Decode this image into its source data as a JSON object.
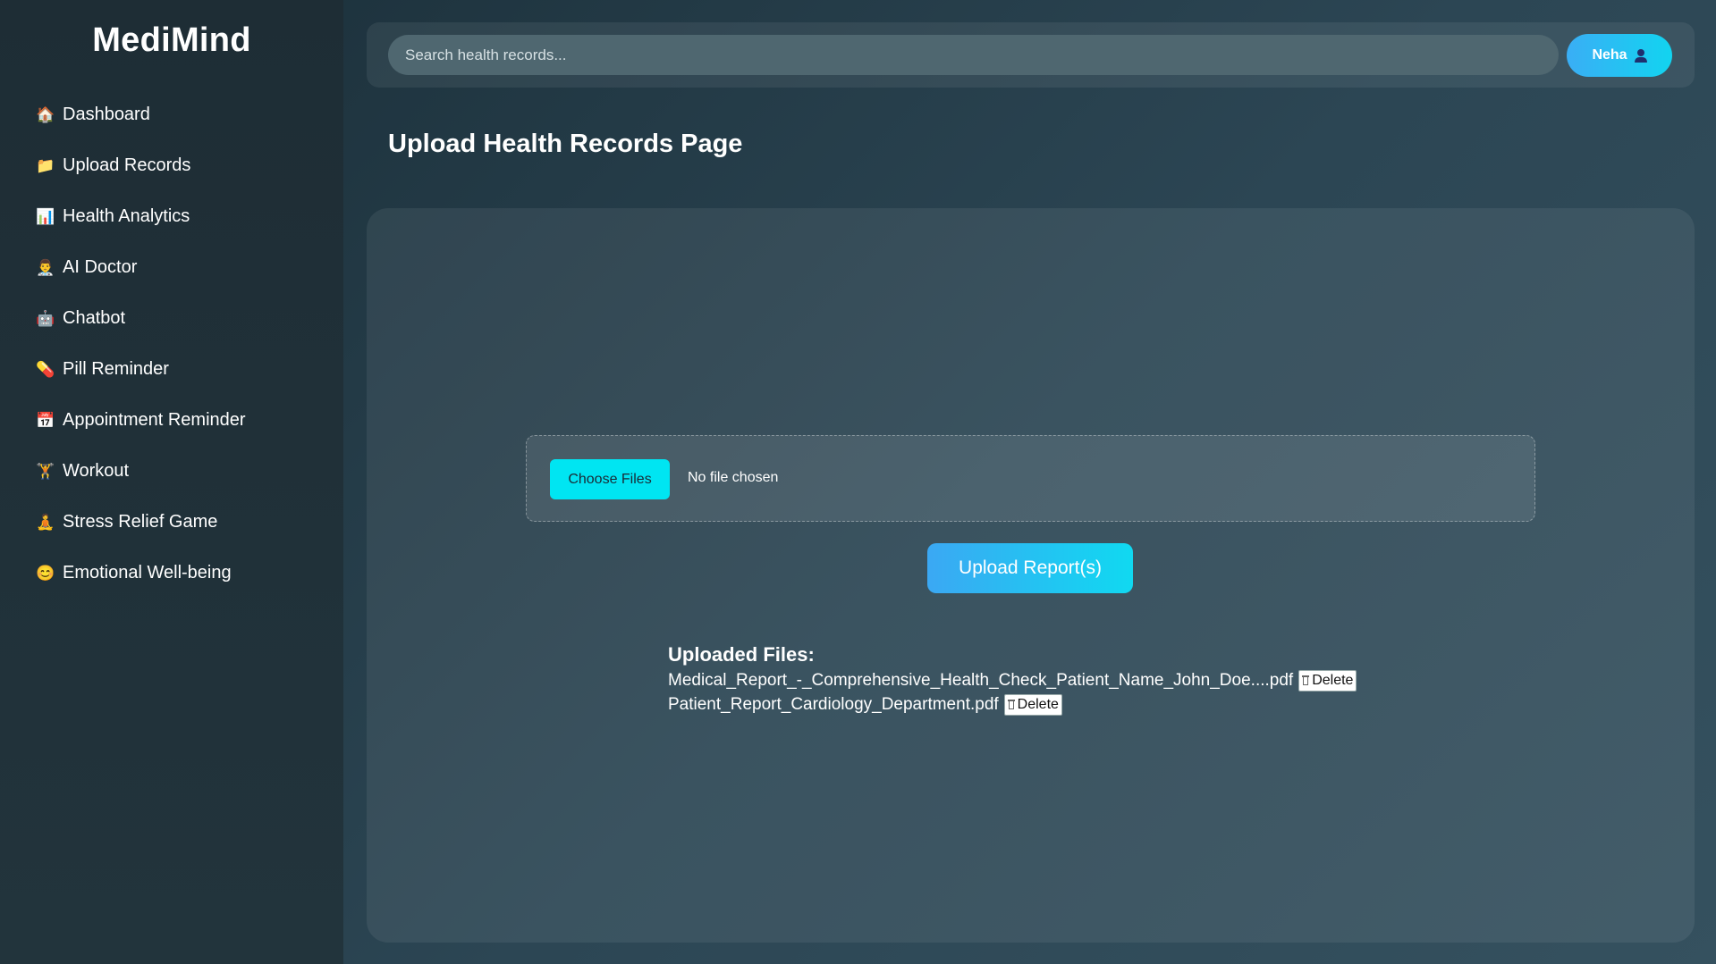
{
  "app": {
    "name": "MediMind"
  },
  "sidebar": {
    "items": [
      {
        "label": "Dashboard",
        "icon": "house-icon",
        "glyph": "🏠"
      },
      {
        "label": "Upload Records",
        "icon": "folder-icon",
        "glyph": "📁"
      },
      {
        "label": "Health Analytics",
        "icon": "bar-chart-icon",
        "glyph": "📊"
      },
      {
        "label": "AI Doctor",
        "icon": "doctor-icon",
        "glyph": "👨‍⚕️"
      },
      {
        "label": "Chatbot",
        "icon": "robot-icon",
        "glyph": "🤖"
      },
      {
        "label": "Pill Reminder",
        "icon": "pill-icon",
        "glyph": "💊"
      },
      {
        "label": "Appointment Reminder",
        "icon": "calendar-icon",
        "glyph": "📅"
      },
      {
        "label": "Workout",
        "icon": "dumbbell-icon",
        "glyph": "🏋️"
      },
      {
        "label": "Stress Relief Game",
        "icon": "meditation-icon",
        "glyph": "🧘"
      },
      {
        "label": "Emotional Well-being",
        "icon": "smile-icon",
        "glyph": "😊"
      }
    ]
  },
  "header": {
    "search_placeholder": "Search health records...",
    "user_name": "Neha",
    "user_icon": "user-icon"
  },
  "main": {
    "title": "Upload Health Records Page",
    "choose_files_label": "Choose Files",
    "no_file_text": "No file chosen",
    "upload_label": "Upload Report(s)",
    "uploaded_heading": "Uploaded Files:",
    "files": [
      {
        "name": "Medical_Report_-_Comprehensive_Health_Check_Patient_Name_John_Doe....pdf",
        "delete_label": "Delete"
      },
      {
        "name": "Patient_Report_Cardiology_Department.pdf",
        "delete_label": "Delete"
      }
    ]
  },
  "colors": {
    "accent": "#00e5f2",
    "button_gradient_start": "#3ba8f3",
    "button_gradient_end": "#10d9f1"
  }
}
